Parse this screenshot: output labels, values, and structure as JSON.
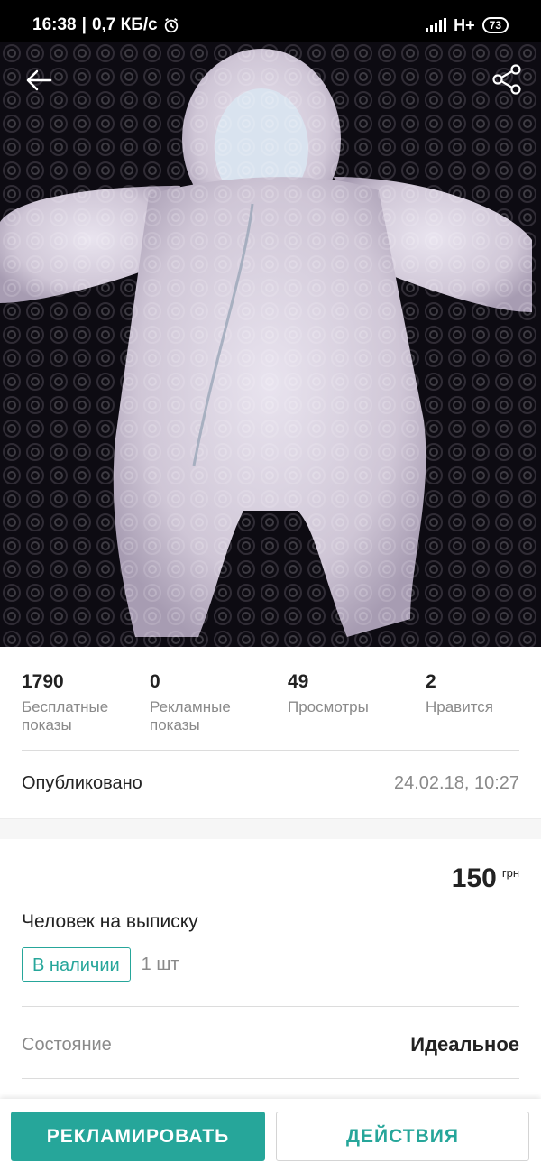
{
  "status_bar": {
    "time": "16:38",
    "speed": "0,7 КБ/с",
    "network": "H+",
    "battery": "73",
    "icons": [
      "alarm-icon",
      "signal-icon",
      "battery-icon"
    ]
  },
  "toolbar": {
    "back_icon": "arrow-left-icon",
    "share_icon": "share-icon"
  },
  "photo": {
    "subject": "product-photo",
    "background_color": "#0d0b12"
  },
  "stats": [
    {
      "value": "1790",
      "label_line1": "Бесплатные",
      "label_line2": "показы"
    },
    {
      "value": "0",
      "label_line1": "Рекламные",
      "label_line2": "показы"
    },
    {
      "value": "49",
      "label_line1": "Просмотры",
      "label_line2": ""
    },
    {
      "value": "2",
      "label_line1": "Нравится",
      "label_line2": ""
    }
  ],
  "published": {
    "label": "Опубликовано",
    "date": "24.02.18, 10:27"
  },
  "listing": {
    "price": "150",
    "currency": "грн",
    "title": "Человек на выписку",
    "stock_badge": "В наличии",
    "quantity": "1 шт",
    "condition_label": "Состояние",
    "condition_value": "Идеальное"
  },
  "buttons": {
    "promote": "РЕКЛАМИРОВАТЬ",
    "actions": "ДЕЙСТВИЯ"
  },
  "colors": {
    "accent": "#26a69a",
    "text_primary": "#222222",
    "text_secondary": "#8a8a8a"
  }
}
